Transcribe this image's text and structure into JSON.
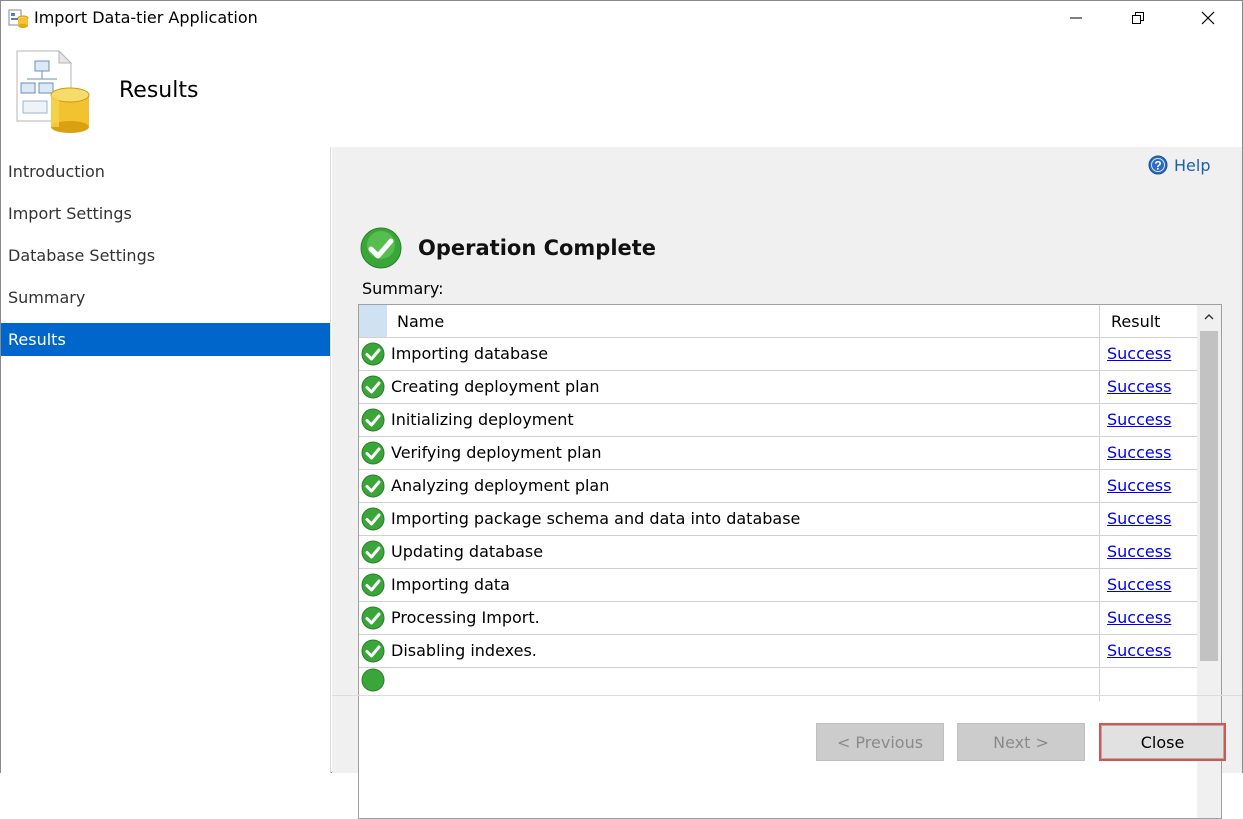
{
  "window": {
    "title": "Import Data-tier Application"
  },
  "header": {
    "title": "Results"
  },
  "nav": {
    "items": [
      {
        "label": "Introduction",
        "active": false
      },
      {
        "label": "Import Settings",
        "active": false
      },
      {
        "label": "Database Settings",
        "active": false
      },
      {
        "label": "Summary",
        "active": false
      },
      {
        "label": "Results",
        "active": true
      }
    ]
  },
  "content": {
    "help_label": "Help",
    "status_title": "Operation Complete",
    "summary_label": "Summary:",
    "table": {
      "columns": [
        "Name",
        "Result"
      ],
      "rows": [
        {
          "name": "Importing database",
          "result": "Success"
        },
        {
          "name": "Creating deployment plan",
          "result": "Success"
        },
        {
          "name": "Initializing deployment",
          "result": "Success"
        },
        {
          "name": "Verifying deployment plan",
          "result": "Success"
        },
        {
          "name": "Analyzing deployment plan",
          "result": "Success"
        },
        {
          "name": "Importing package schema and data into database",
          "result": "Success"
        },
        {
          "name": "Updating database",
          "result": "Success"
        },
        {
          "name": "Importing data",
          "result": "Success"
        },
        {
          "name": "Processing Import.",
          "result": "Success"
        },
        {
          "name": "Disabling indexes.",
          "result": "Success"
        }
      ]
    }
  },
  "footer": {
    "previous_label": "< Previous",
    "next_label": "Next >",
    "close_label": "Close"
  },
  "colors": {
    "nav_active": "#0066cc",
    "link": "#0000ee",
    "success": "#3aa63a",
    "close_highlight": "#d9534f"
  }
}
